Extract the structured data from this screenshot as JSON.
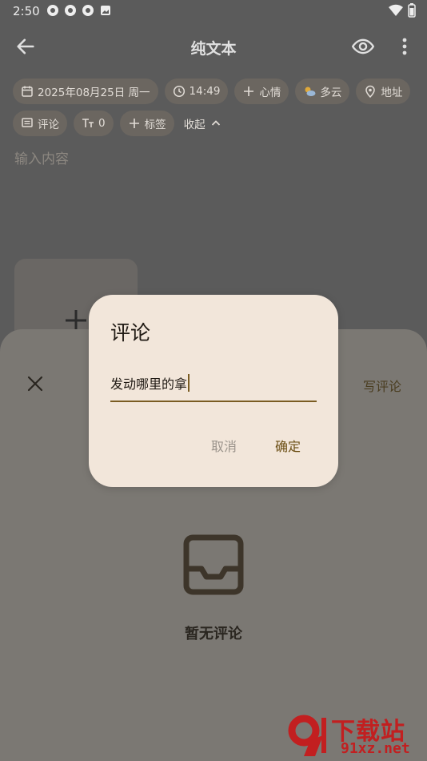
{
  "status_bar": {
    "time": "2:50"
  },
  "app_bar": {
    "title": "纯文本"
  },
  "chips_row1": {
    "date": "2025年08月25日 周一",
    "time": "14:49",
    "mood": "心情",
    "weather": "多云",
    "location": "地址"
  },
  "chips_row2": {
    "comment": "评论",
    "font_size": "0",
    "tag": "标签",
    "collapse": "收起"
  },
  "editor": {
    "placeholder": "输入内容"
  },
  "sheet": {
    "write_comment": "写评论",
    "empty_text": "暂无评论"
  },
  "dialog": {
    "title": "评论",
    "input_value": "发动哪里的拿",
    "cancel": "取消",
    "confirm": "确定"
  },
  "watermark": {
    "brand": "下载站",
    "domain": "91xz.net"
  },
  "colors": {
    "accent": "#7a5c22",
    "dialog_bg": "#f2e6da",
    "watermark": "#c21f20"
  }
}
